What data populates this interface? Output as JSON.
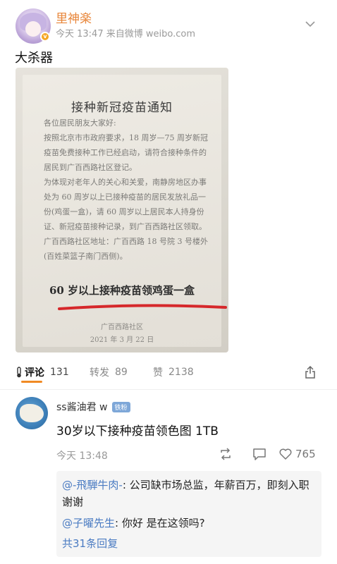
{
  "post": {
    "username": "里神楽",
    "meta": "今天 13:47  来自微博 weibo.com",
    "text": "大杀器"
  },
  "notice": {
    "title": "接种新冠疫苗通知",
    "greeting": "各位居民朋友大家好:",
    "para1": "按照北京市市政府要求，18 周岁—75 周岁新冠疫苗免费接种工作已经启动，请符合接种条件的居民到广百西路社区登记。",
    "para2": "为体现对老年人的关心和关爱，南静房地区办事处为 60 周岁以上已接种疫苗的居民发放礼品一份(鸡蛋一盒)，请 60 周岁以上居民本人持身份证、新冠疫苗接种记录，到广百西路社区领取。",
    "address": "广百西路社区地址：广百西路 18 号院 3 号楼外(百姓菜篮子南门西侧)。",
    "headline": "60 岁以上接种疫苗领鸡蛋一盒",
    "sign_org": "广百西路社区",
    "sign_date": "2021 年 3 月 22 日"
  },
  "actions": {
    "comment_label": "评论",
    "comment_count": "131",
    "repost_label": "转发",
    "repost_count": "89",
    "like_label": "赞",
    "like_count": "2138"
  },
  "comment": {
    "name": "ss酱油君 w",
    "badge": "铁粉",
    "text": "30岁以下接种疫苗领色图 1TB",
    "time": "今天 13:48",
    "likes": "765",
    "replies": [
      {
        "who": "@-飛騨牛肉-",
        "text": ": 公司缺市场总监，年薪百万，即刻入职谢谢"
      },
      {
        "who": "@子曜先生",
        "text": ": 你好 是在这领吗?"
      }
    ],
    "more": "共31条回复"
  },
  "colors": {
    "accent": "#f08a24",
    "link": "#4a7bc2",
    "username": "#e8863a"
  }
}
